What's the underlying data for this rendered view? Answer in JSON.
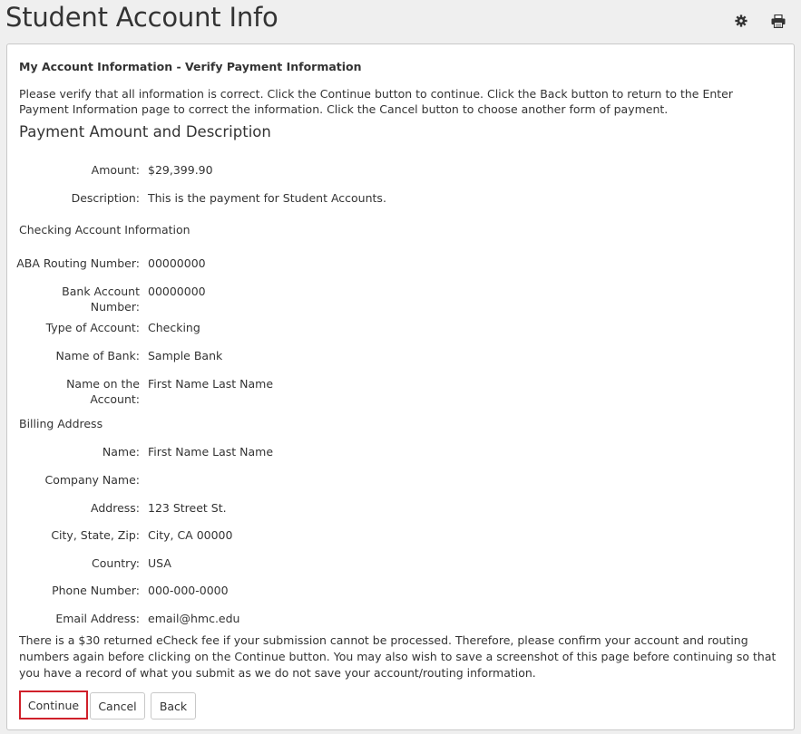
{
  "header": {
    "title": "Student Account Info",
    "icons": [
      "gear-icon",
      "print-icon"
    ]
  },
  "panel": {
    "heading": "My Account Information - Verify Payment Information",
    "intro": "Please verify that all information is correct. Click the Continue button to continue. Click the Back button to return to the Enter Payment Information page to correct the information. Click the Cancel button to choose another form of payment.",
    "payment_section": {
      "title": "Payment Amount and Description",
      "amount_label": "Amount:",
      "amount_value": "$29,399.90",
      "description_label": "Description:",
      "description_value": "This is the payment for Student Accounts."
    },
    "checking_section": {
      "title": "Checking Account Information",
      "routing_label": "ABA Routing Number:",
      "routing_value": "00000000",
      "account_label_line1": "Bank Account",
      "account_label_line2": "Number:",
      "account_value": "00000000",
      "type_label": "Type of Account:",
      "type_value": "Checking",
      "bank_label": "Name of Bank:",
      "bank_value": "Sample Bank",
      "name_label_line1": "Name on the",
      "name_label_line2": "Account:",
      "name_value": "First Name Last Name"
    },
    "billing_section": {
      "title": "Billing Address",
      "name_label": "Name:",
      "name_value": "First Name Last Name",
      "company_label": "Company Name:",
      "company_value": "",
      "address_label": "Address:",
      "address_value": "123 Street St.",
      "city_label": "City, State, Zip:",
      "city_value": "City, CA 00000",
      "country_label": "Country:",
      "country_value": "USA",
      "phone_label": "Phone Number:",
      "phone_value": "000-000-0000",
      "email_label": "Email Address:",
      "email_value": "email@hmc.edu"
    },
    "disclaimer": "There is a $30 returned eCheck fee if your submission cannot be processed. Therefore, please confirm your account and routing numbers again before clicking on the Continue button. You may also wish to save a screenshot of this page before continuing so that you have a record of what you submit as we do not save your account/routing information.",
    "buttons": {
      "continue": "Continue",
      "cancel": "Cancel",
      "back": "Back"
    }
  },
  "colors": {
    "page_bg": "#efefef",
    "panel_bg": "#ffffff",
    "text": "#333333",
    "highlight_border": "#d0202a"
  }
}
